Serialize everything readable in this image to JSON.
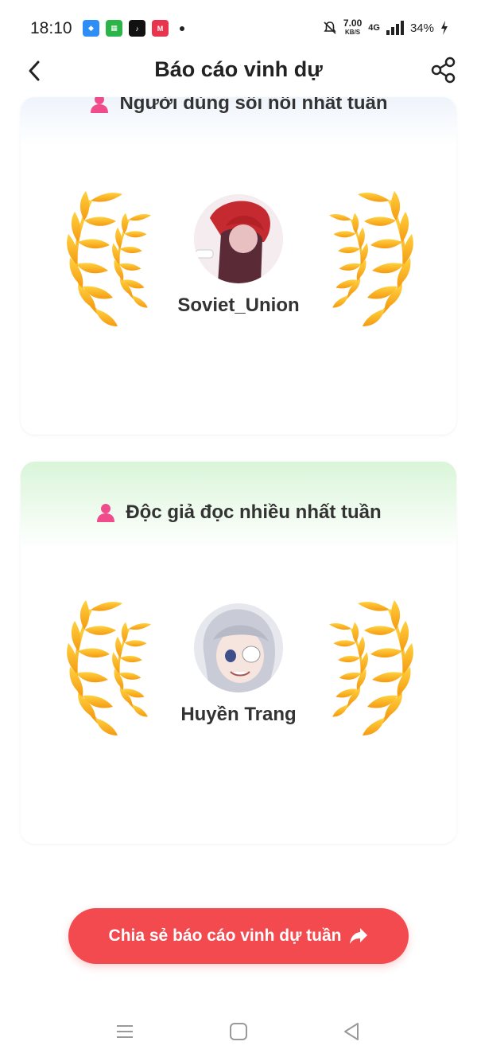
{
  "status": {
    "time": "18:10",
    "net_speed": "7.00",
    "net_unit": "KB/S",
    "network": "4G",
    "battery": "34%"
  },
  "header": {
    "title": "Báo cáo vinh dự"
  },
  "cards": [
    {
      "heading": "Người dùng sôi nổi nhất tuần",
      "username": "Soviet_Union"
    },
    {
      "heading": "Độc giả đọc nhiều nhất tuần",
      "username": "Huyền Trang"
    }
  ],
  "share_button": {
    "label": "Chia sẻ báo cáo vinh dự tuần"
  },
  "colors": {
    "accent_red": "#f24a4e",
    "wreath_gold": "#f7b21c",
    "icon_pink": "#f04c8c"
  }
}
